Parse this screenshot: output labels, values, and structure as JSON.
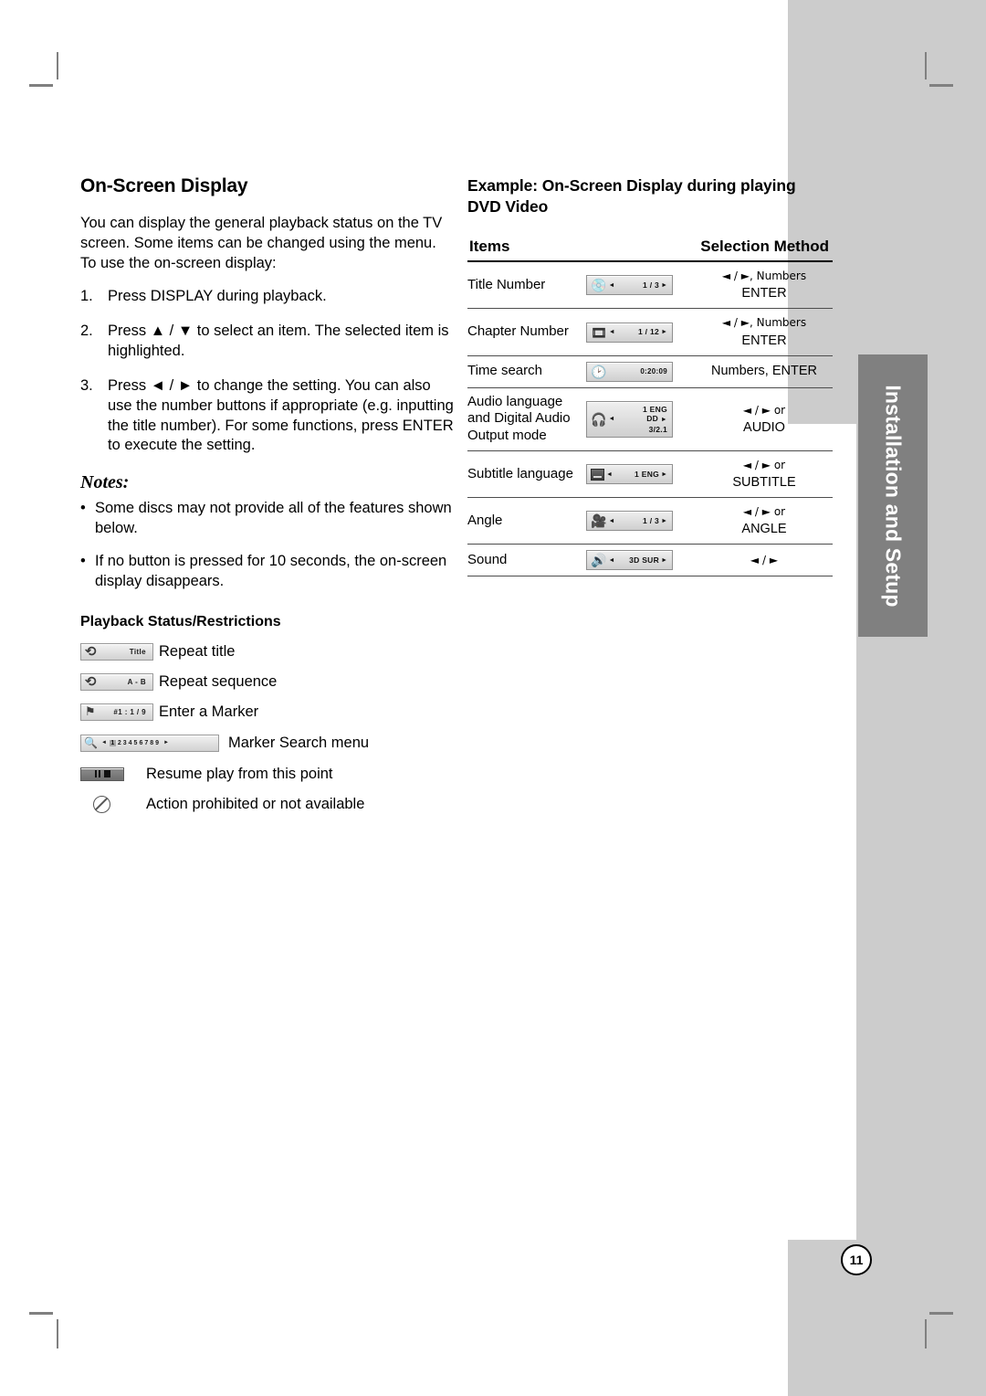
{
  "page": {
    "number": "11",
    "side_tab_label": "Installation and Setup"
  },
  "left_column": {
    "title": "On-Screen Display",
    "intro": "You can display the general playback status on the TV screen. Some items can be changed using the menu. To use the on-screen display:",
    "steps": [
      {
        "num": "1.",
        "text": "Press DISPLAY during playback."
      },
      {
        "num": "2.",
        "text": "Press ▲ / ▼ to select an item. The selected item is highlighted."
      },
      {
        "num": "3.",
        "text": "Press ◄ / ► to change the setting. You can also use the number buttons if appropriate (e.g. inputting the title number). For some functions, press ENTER to execute the setting."
      }
    ],
    "notes_heading": "Notes:",
    "notes": [
      {
        "bullet": "•",
        "text": "Some discs may not provide all of the features shown below."
      },
      {
        "bullet": "•",
        "text": "If no button is pressed for 10 seconds, the on-screen display disappears."
      }
    ],
    "playback_heading": "Playback Status/Restrictions",
    "playback_items": [
      {
        "icon": "repeat-title-icon",
        "chip_text": "Title",
        "label": "Repeat title"
      },
      {
        "icon": "repeat-ab-icon",
        "chip_text": "A - B",
        "label": "Repeat sequence"
      },
      {
        "icon": "marker-icon",
        "chip_text": "#1 : 1 / 9",
        "label": "Enter a Marker"
      },
      {
        "icon": "marker-search-icon",
        "chip_text": "1 2 3 4 5 6 7 8 9",
        "label": "Marker Search menu"
      },
      {
        "icon": "resume-icon",
        "chip_text": "",
        "label": "Resume play from this point"
      },
      {
        "icon": "prohibited-icon",
        "chip_text": "",
        "label": "Action prohibited or not available"
      }
    ],
    "marker_search": {
      "left_arrow": "◄",
      "right_arrow": "►",
      "numbers": [
        "1",
        "2",
        "3",
        "4",
        "5",
        "6",
        "7",
        "8",
        "9"
      ],
      "selected": "1"
    }
  },
  "right_column": {
    "title": "Example: On-Screen Display during playing DVD Video",
    "table": {
      "headers": {
        "items": "Items",
        "selection": "Selection Method"
      },
      "rows": [
        {
          "item": "Title Number",
          "osd_icon": "disc-icon",
          "osd_left_arrow": "◄",
          "osd_right_arrow": "►",
          "osd_value": [
            "1 / 3"
          ],
          "selection": [
            "◄ / ►, Numbers",
            "ENTER"
          ]
        },
        {
          "item": "Chapter Number",
          "osd_icon": "film-strip-icon",
          "osd_left_arrow": "◄",
          "osd_right_arrow": "►",
          "osd_value": [
            "1 / 12"
          ],
          "selection": [
            "◄ / ►, Numbers",
            "ENTER"
          ]
        },
        {
          "item": "Time search",
          "osd_icon": "clock-icon",
          "osd_left_arrow": "",
          "osd_right_arrow": "",
          "osd_value": [
            "0:20:09"
          ],
          "selection": [
            "Numbers, ENTER"
          ]
        },
        {
          "item": "Audio language and Digital Audio Output mode",
          "osd_icon": "headphones-icon",
          "osd_left_arrow": "◄",
          "osd_right_arrow": "►",
          "osd_value": [
            "1 ENG",
            "DD",
            "3/2.1"
          ],
          "selection": [
            "◄ / ► or",
            "AUDIO"
          ]
        },
        {
          "item": "Subtitle language",
          "osd_icon": "subtitle-icon",
          "osd_left_arrow": "◄",
          "osd_right_arrow": "►",
          "osd_value": [
            "1 ENG"
          ],
          "selection": [
            "◄ / ► or",
            "SUBTITLE"
          ]
        },
        {
          "item": "Angle",
          "osd_icon": "camera-icon",
          "osd_left_arrow": "◄",
          "osd_right_arrow": "►",
          "osd_value": [
            "1 / 3"
          ],
          "selection": [
            "◄ / ► or",
            "ANGLE"
          ]
        },
        {
          "item": "Sound",
          "osd_icon": "sound-icon",
          "osd_left_arrow": "◄",
          "osd_right_arrow": "►",
          "osd_value": [
            "3D SUR"
          ],
          "selection": [
            "◄ / ►"
          ]
        }
      ]
    }
  },
  "colors": {
    "page_background": "#ffffff",
    "margin_gray": "#cccccc",
    "tab_gray": "#808080",
    "text": "#000000"
  }
}
